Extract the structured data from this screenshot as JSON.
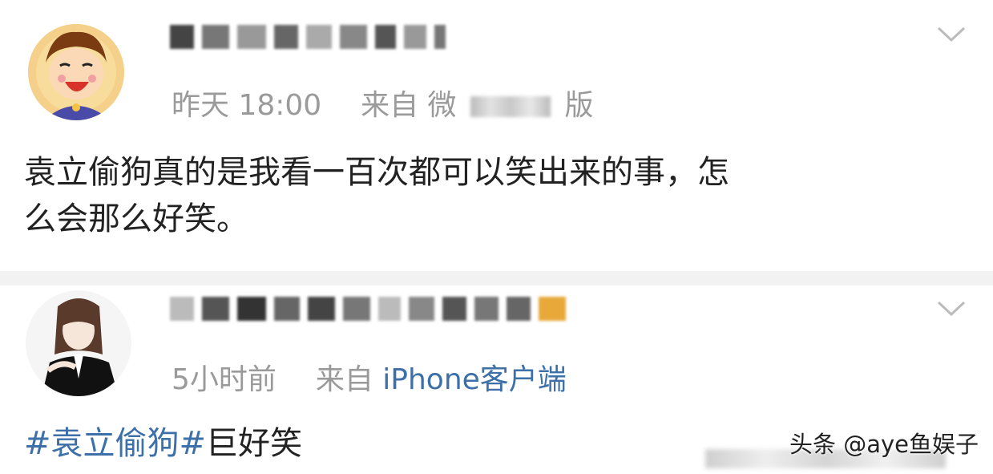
{
  "posts": [
    {
      "avatar_icon": "cartoon-boy-avatar-icon",
      "username": "",
      "meta_time": "昨天 18:00",
      "meta_source_prefix": "来自 微",
      "meta_source_suffix": "版",
      "content_line1": "袁立偷狗真的是我看一百次都可以笑出来的事，怎",
      "content_line2": "么会那么好笑。"
    },
    {
      "avatar_icon": "anime-character-avatar-icon",
      "username": "",
      "meta_time": "5小时前",
      "meta_source_prefix": "来自",
      "meta_source_link": "iPhone客户端",
      "content_hashtag": "#袁立偷狗#",
      "content_text": "巨好笑"
    }
  ],
  "watermark": "头条 @aye鱼娱子",
  "colors": {
    "link": "#3d6fa8",
    "meta": "#9a9a9a",
    "text": "#222222",
    "divider": "#f2f2f2"
  }
}
